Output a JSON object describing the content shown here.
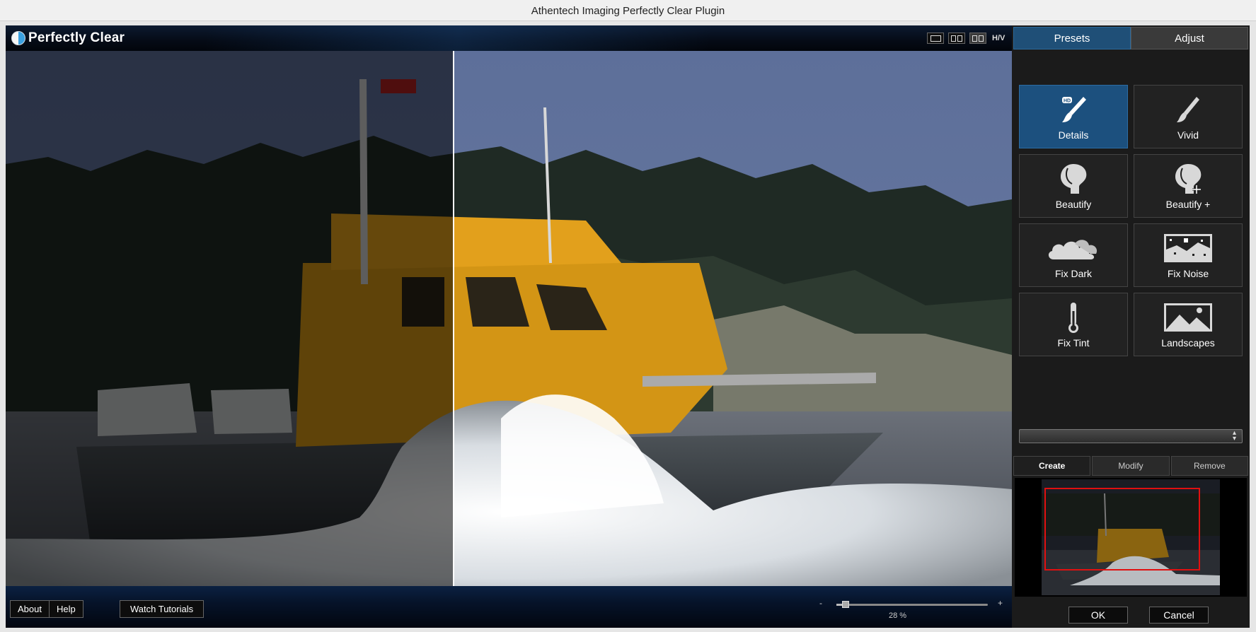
{
  "window": {
    "title": "Athentech Imaging Perfectly Clear Plugin"
  },
  "app": {
    "logo_text": "Perfectly Clear"
  },
  "view_controls": {
    "hv_label": "H/V"
  },
  "bottom": {
    "about_label": "About",
    "help_label": "Help",
    "tutorials_label": "Watch Tutorials",
    "zoom_minus": "-",
    "zoom_plus": "+",
    "zoom_text": "28 %",
    "zoom_value": 0.06
  },
  "panel": {
    "tabs": [
      {
        "label": "Presets"
      },
      {
        "label": "Adjust"
      }
    ],
    "presets": [
      {
        "label": "Details",
        "icon": "brush-hd-icon"
      },
      {
        "label": "Vivid",
        "icon": "brush-icon"
      },
      {
        "label": "Beautify",
        "icon": "face-profile-icon"
      },
      {
        "label": "Beautify +",
        "icon": "face-profile-plus-icon"
      },
      {
        "label": "Fix Dark",
        "icon": "cloud-icon"
      },
      {
        "label": "Fix Noise",
        "icon": "noise-icon"
      },
      {
        "label": "Fix Tint",
        "icon": "thermometer-icon"
      },
      {
        "label": "Landscapes",
        "icon": "landscape-icon"
      }
    ],
    "preset_dropdown_value": "",
    "actions": [
      {
        "label": "Create"
      },
      {
        "label": "Modify"
      },
      {
        "label": "Remove"
      }
    ],
    "ok_label": "OK",
    "cancel_label": "Cancel"
  },
  "colors": {
    "accent": "#1f4f77",
    "navigator_rect": "#e01010"
  }
}
